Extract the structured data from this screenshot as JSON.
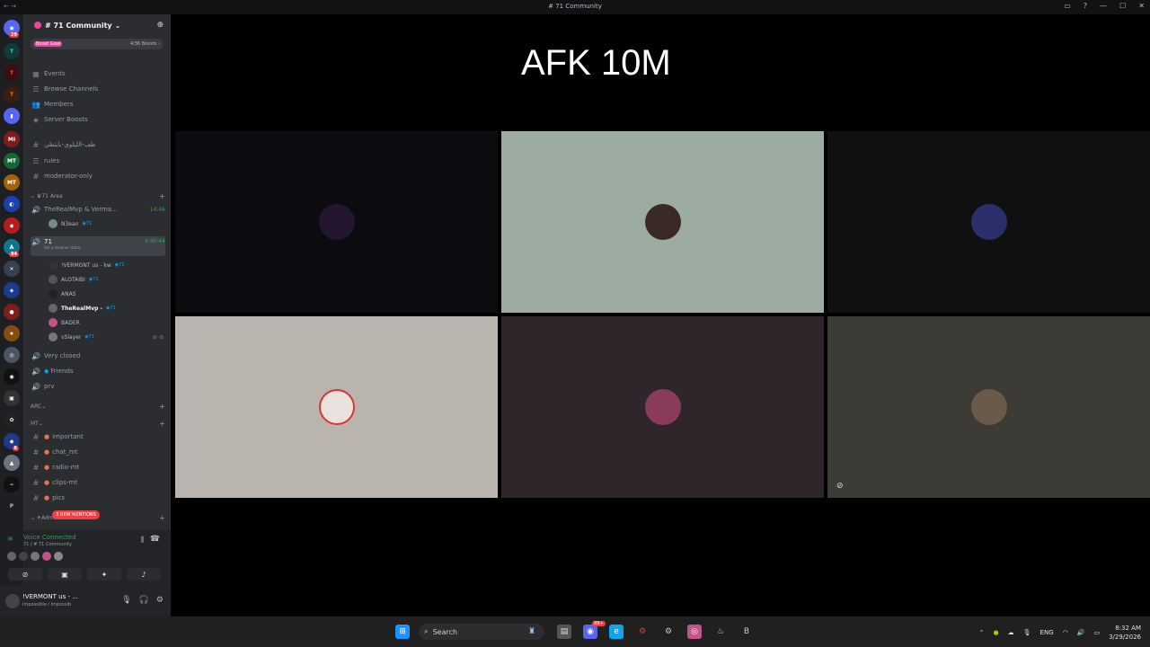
{
  "window": {
    "title": "# 71 Community",
    "controls": [
      "—",
      "☐",
      "✕"
    ]
  },
  "rail": {
    "badges": {
      "home": "29",
      "s12": "94",
      "s20": "6"
    }
  },
  "guild": {
    "name": "# 71 Community",
    "boost_goal": "Boost Goal",
    "boost_count": "4/36 Boosts ›"
  },
  "nav": [
    {
      "icon": "▦",
      "label": "Events"
    },
    {
      "icon": "☰",
      "label": "Browse Channels"
    },
    {
      "icon": "👥",
      "label": "Members"
    },
    {
      "icon": "◈",
      "label": "Server Boosts"
    }
  ],
  "channels": [
    {
      "icon": "#",
      "label": "طف-الليلوي-بايتظي"
    },
    {
      "icon": "☰",
      "label": "rules"
    },
    {
      "icon": "#",
      "label": "moderator-only"
    }
  ],
  "voice_category": {
    "label": "71 Area"
  },
  "voice1": {
    "label": "TheRealMvp & Verma...",
    "time": "14:46",
    "member": "N3ean",
    "member_tag": "◉71"
  },
  "voice2": {
    "label": "71",
    "time": "4:46:44",
    "status": "Set a channel status"
  },
  "voice2_members": [
    {
      "name": "!VERMONT us - kw",
      "tag": "◉71"
    },
    {
      "name": "ALOTAIBI",
      "tag": "◉71"
    },
    {
      "name": "ANAS",
      "tag": ""
    },
    {
      "name": "TheRealMvp -",
      "tag": "◉71"
    },
    {
      "name": "BADER",
      "tag": ""
    },
    {
      "name": "vSlayer",
      "tag": "◉71"
    }
  ],
  "more_voice": [
    {
      "label": "Very closed"
    },
    {
      "label": "Friends"
    },
    {
      "label": "prv"
    }
  ],
  "cat_arc": "ARC",
  "cat_mt": "MT",
  "mt_channels": [
    {
      "label": "important"
    },
    {
      "label": "chat_mt"
    },
    {
      "label": "radio-mt"
    },
    {
      "label": "clips-mt"
    },
    {
      "label": "pics"
    }
  ],
  "admin_cat": "Admi",
  "mentions": "3 NEW MENTIONS",
  "voice_conn": {
    "label": "Voice Connected",
    "sub": "71 / # 71 Community"
  },
  "user": {
    "name": "!VERMONT us - ...",
    "status": "Impossible / Impossib"
  },
  "stage": {
    "title": "AFK 10M"
  },
  "taskbar": {
    "search": "Search",
    "lang": "ENG",
    "time": "8:32 AM",
    "date": "3/29/2026",
    "discord_badge": "99+"
  },
  "colors": {
    "accent": "#5865f2",
    "online": "#23a559",
    "danger": "#f23f43",
    "pink": "#eb459e"
  }
}
